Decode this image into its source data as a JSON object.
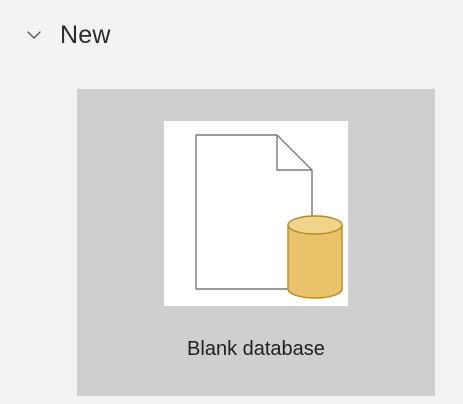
{
  "section": {
    "title": "New",
    "expanded_icon": "chevron-down-icon"
  },
  "templates": [
    {
      "label": "Blank database",
      "icon": "blank-database-icon",
      "colors": {
        "tile_background": "#cfcfcf",
        "thumbnail_background": "#ffffff",
        "database_fill": "#e8c36a",
        "database_stroke": "#b58a23"
      }
    }
  ]
}
